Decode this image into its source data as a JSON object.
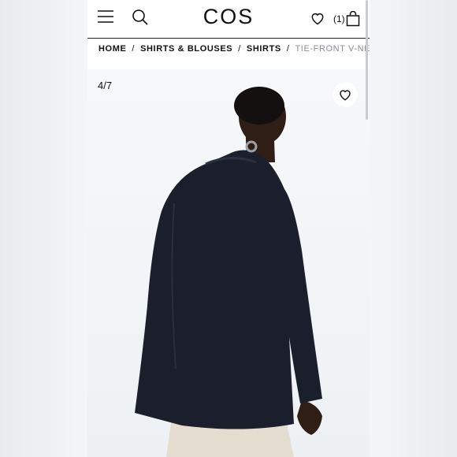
{
  "header": {
    "logo": "COS",
    "cart_count": "(1)",
    "icons": [
      "menu-icon",
      "search-icon",
      "heart-icon",
      "bag-icon"
    ]
  },
  "breadcrumb": {
    "items": [
      "HOME",
      "SHIRTS & BLOUSES",
      "SHIRTS"
    ],
    "separator": "/",
    "current": "TIE-FRONT V-NECK"
  },
  "gallery": {
    "counter": "4/7",
    "colors": {
      "jacket": "#1b1f2b",
      "skin": "#2e1e16",
      "trousers": "#e4ddd0"
    }
  }
}
